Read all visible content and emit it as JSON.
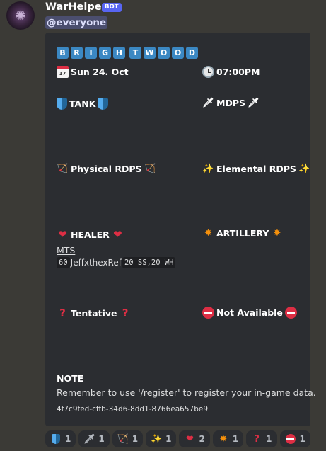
{
  "message": {
    "username": "WarHelper",
    "badge": "BOT",
    "mention": "@everyone"
  },
  "embed": {
    "title_letters": [
      "B",
      "R",
      "I",
      "G",
      "H",
      "T",
      "W",
      "O",
      "O",
      "D"
    ],
    "date": {
      "icon": "calendar-icon",
      "text": "Sun 24. Oct"
    },
    "time": {
      "icon": "clock-icon",
      "text": "07:00PM"
    },
    "roles": {
      "tank": {
        "label": "TANK",
        "icon": "shield-icon"
      },
      "mdps": {
        "label": "MDPS",
        "icon": "dagger-icon"
      },
      "physical_rdps": {
        "label": "Physical RDPS",
        "icon": "bow-icon"
      },
      "elemental_rdps": {
        "label": "Elemental RDPS",
        "icon": "magic-wand-icon"
      },
      "healer": {
        "label": "HEALER",
        "icon": "heart-icon"
      },
      "artillery": {
        "label": "ARTILLERY",
        "icon": "collision-icon"
      },
      "tentative": {
        "label": "Tentative",
        "icon": "question-icon"
      },
      "not_available": {
        "label": "Not Available",
        "icon": "no-entry-icon"
      }
    },
    "healer_link": "MTS",
    "healer_entry": {
      "level": "60",
      "name": "JeffxthexRef",
      "stats": "20 SS,20 WH"
    },
    "note_title": "NOTE",
    "note_text": "Remember to use '/register' to register your in-game data.",
    "event_id": "4f7c9fed-cffb-34d6-8dd1-8766ea657be9"
  },
  "reactions": [
    {
      "icon": "shield-icon",
      "count": "1"
    },
    {
      "icon": "dagger-icon",
      "count": "1"
    },
    {
      "icon": "bow-icon",
      "count": "1"
    },
    {
      "icon": "magic-wand-icon",
      "count": "1"
    },
    {
      "icon": "heart-icon",
      "count": "2"
    },
    {
      "icon": "collision-icon",
      "count": "1"
    },
    {
      "icon": "question-icon",
      "count": "1"
    },
    {
      "icon": "no-entry-icon",
      "count": "1"
    }
  ],
  "colors": {
    "background": "#3b3a36",
    "embed": "#2b2d31",
    "letter_tile": "#3b88c3",
    "bot_badge": "#5865f2",
    "mention": "#4b4e6e"
  }
}
